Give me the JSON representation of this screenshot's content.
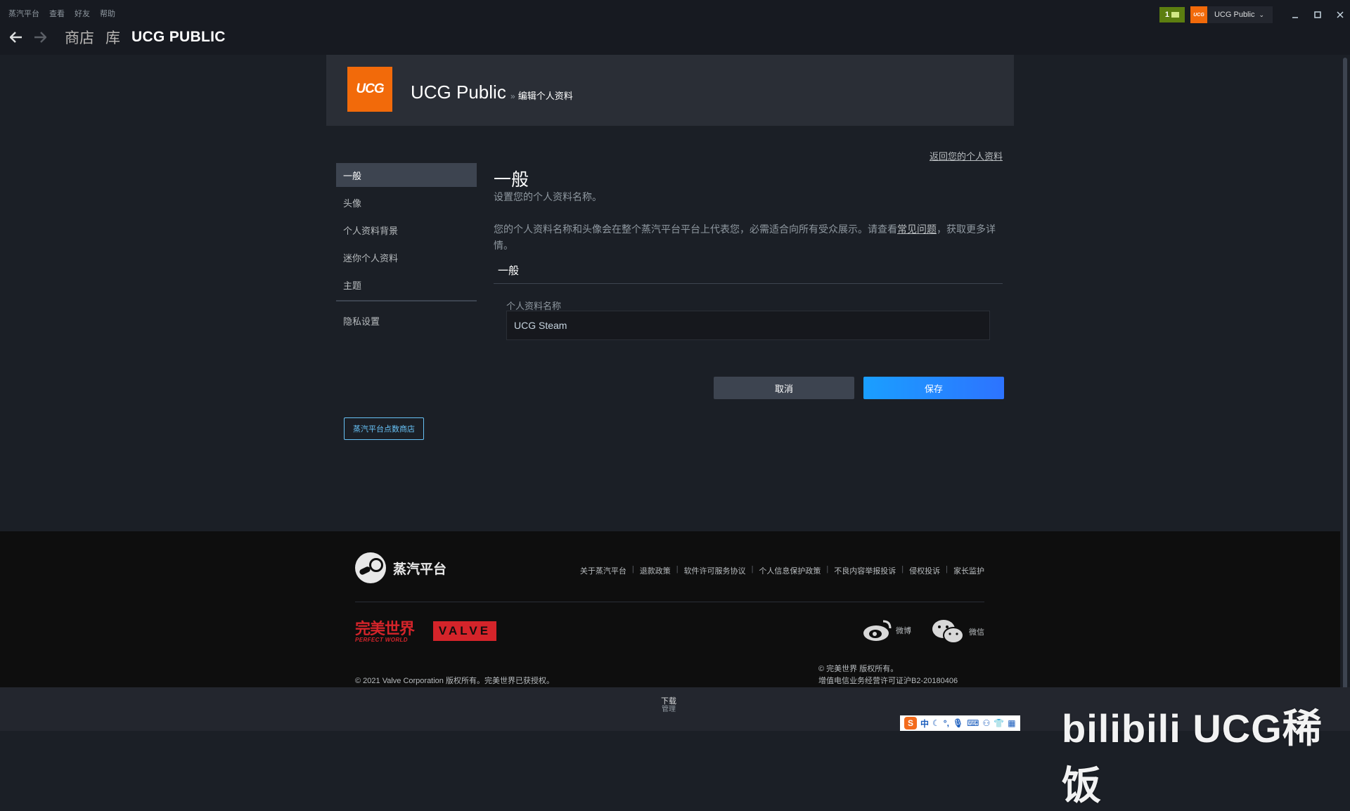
{
  "menu": [
    "蒸汽平台",
    "查看",
    "好友",
    "帮助"
  ],
  "nav": {
    "tabs": [
      "商店",
      "库",
      "UCG PUBLIC"
    ]
  },
  "titlebar": {
    "notification_count": "1",
    "account_name": "UCG Public",
    "avatar_text": "UCG"
  },
  "profile": {
    "name": "UCG Public",
    "breadcrumb_sep": "»",
    "breadcrumb": "编辑个人资料",
    "avatar_text": "UCG"
  },
  "sidebar": {
    "items": [
      "一般",
      "头像",
      "个人资料背景",
      "迷你个人资料",
      "主题"
    ],
    "privacy": "隐私设置",
    "points_shop": "蒸汽平台点数商店"
  },
  "main": {
    "back_link": "返回您的个人资料",
    "title": "一般",
    "subtitle": "设置您的个人资料名称。",
    "description": "您的个人资料名称和头像会在整个蒸汽平台平台上代表您，必需适合向所有受众展示。请查看",
    "faq_link": "常见问题",
    "description_end": "，获取更多详情。",
    "group_title": "一般",
    "field_label": "个人资料名称",
    "field_value": "UCG Steam",
    "cancel": "取消",
    "save": "保存"
  },
  "footer": {
    "brand": "蒸汽平台",
    "links": [
      "关于蒸汽平台",
      "退款政策",
      "软件许可服务协议",
      "个人信息保护政策",
      "不良内容举报投诉",
      "侵权投诉",
      "家长监护"
    ],
    "pw_cn": "完美世界",
    "pw_en": "PERFECT WORLD",
    "valve": "VALVE",
    "weibo": "微博",
    "wechat": "微信",
    "copyright_left": "© 2021 Valve Corporation 版权所有。完美世界已获授权。",
    "copyright_right_1": "© 完美世界 版权所有。",
    "copyright_right_2": "增值电信业务经营许可证沪B2-20180406"
  },
  "bottombar": {
    "downloads": "下载",
    "manage": "管理"
  },
  "ime": {
    "lang": "中"
  },
  "watermark": "bilibili UCG稀饭",
  "colors": {
    "accent": "#1a9fff",
    "avatar_orange": "#f26a0a",
    "brand_red": "#d4242a",
    "notification_green": "#5c7e10"
  }
}
